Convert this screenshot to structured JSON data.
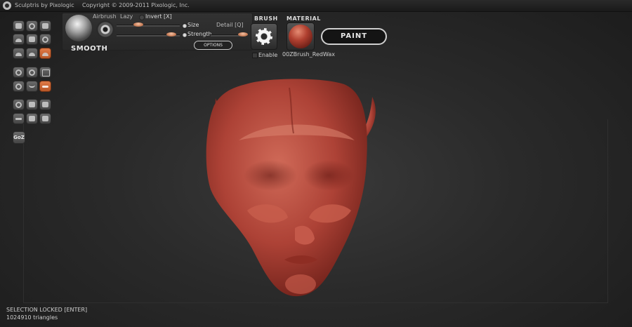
{
  "titlebar": {
    "app_name": "Sculptris by Pixologic",
    "copyright": "Copyright © 2009-2011 Pixologic, Inc."
  },
  "brush_panel": {
    "tool_name": "SMOOTH",
    "airbrush_label": "Airbrush",
    "lazy_label": "Lazy",
    "invert_label": "Invert [X]",
    "size_label": "Size",
    "strength_label": "Strength",
    "detail_label": "Detail [Q]",
    "options_label": "OPTIONS"
  },
  "brush_section": {
    "title": "BRUSH",
    "enable_label": "Enable"
  },
  "material_section": {
    "title": "MATERIAL",
    "material_name": "00ZBrush_RedWax"
  },
  "paint_button": {
    "label": "PAINT"
  },
  "left_tools": {
    "goz_label": "GoZ"
  },
  "status": {
    "selection": "SELECTION LOCKED [ENTER]",
    "triangles": "1024910 triangles"
  },
  "colors": {
    "accent_orange": "#d9703c",
    "model_red": "#b4473a",
    "background": "#2a2a2a"
  }
}
